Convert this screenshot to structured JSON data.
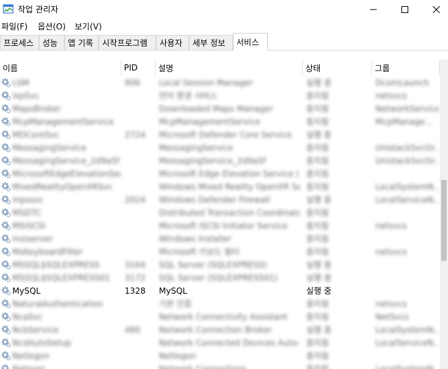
{
  "window": {
    "title": "작업 관리자"
  },
  "menu": [
    "파일(F)",
    "옵션(O)",
    "보기(V)"
  ],
  "tabs": [
    "프로세스",
    "성능",
    "앱 기록",
    "시작프로그램",
    "사용자",
    "세부 정보",
    "서비스"
  ],
  "active_tab": "서비스",
  "columns": {
    "name": "이름",
    "pid": "PID",
    "desc": "설명",
    "state": "상태",
    "group": "그룹"
  },
  "rows": [
    {
      "name": "LSM",
      "pid": "906",
      "desc": "Local Session Manager",
      "state": "실행 중",
      "group": "DcomLaunch",
      "blur": true
    },
    {
      "name": "lxpSvc",
      "pid": "",
      "desc": "언어 환경 서비스",
      "state": "중지됨",
      "group": "netsvcs",
      "blur": true
    },
    {
      "name": "MapsBroker",
      "pid": "",
      "desc": "Downloaded Maps Manager",
      "state": "중지됨",
      "group": "NetworkService",
      "blur": true
    },
    {
      "name": "McpManagementService",
      "pid": "",
      "desc": "McpManagementService",
      "state": "중지됨",
      "group": "McpManage...",
      "blur": true
    },
    {
      "name": "MDCoreSvc",
      "pid": "2724",
      "desc": "Microsoft Defender Core Service",
      "state": "실행 중",
      "group": "",
      "blur": true
    },
    {
      "name": "MessagingService",
      "pid": "",
      "desc": "MessagingService",
      "state": "중지됨",
      "group": "UnistackSvcGr...",
      "blur": true
    },
    {
      "name": "MessagingService_2d9a5f",
      "pid": "",
      "desc": "MessagingService_2d9a5f",
      "state": "중지됨",
      "group": "UnistackSvcGr...",
      "blur": true
    },
    {
      "name": "MicrosoftEdgeElevationSer...",
      "pid": "",
      "desc": "Microsoft Edge Elevation Service (...",
      "state": "중지됨",
      "group": "",
      "blur": true
    },
    {
      "name": "MixedRealityOpenXRSvc",
      "pid": "",
      "desc": "Windows Mixed Reality OpenXR Se...",
      "state": "중지됨",
      "group": "LocalSystemN...",
      "blur": true
    },
    {
      "name": "mpssvc",
      "pid": "2024",
      "desc": "Windows Defender Firewall",
      "state": "실행 중",
      "group": "LocalServiceN...",
      "blur": true
    },
    {
      "name": "MSDTC",
      "pid": "",
      "desc": "Distributed Transaction Coordinator",
      "state": "중지됨",
      "group": "",
      "blur": true
    },
    {
      "name": "MSiSCSI",
      "pid": "",
      "desc": "Microsoft iSCSI Initiator Service",
      "state": "중지됨",
      "group": "netsvcs",
      "blur": true
    },
    {
      "name": "msiserver",
      "pid": "",
      "desc": "Windows Installer",
      "state": "중지됨",
      "group": "",
      "blur": true
    },
    {
      "name": "MsKeyboardFilter",
      "pid": "",
      "desc": "Microsoft 키보드 필터",
      "state": "중지됨",
      "group": "netsvcs",
      "blur": true
    },
    {
      "name": "MSSQL$SQLEXPRESS",
      "pid": "3164",
      "desc": "SQL Server (SQLEXPRESS)",
      "state": "실행 중",
      "group": "",
      "blur": true
    },
    {
      "name": "MSSQL$SQLEXPRESS01",
      "pid": "3172",
      "desc": "SQL Server (SQLEXPRESS01)",
      "state": "실행 중",
      "group": "",
      "blur": true
    },
    {
      "name": "MySQL",
      "pid": "1328",
      "desc": "MySQL",
      "state": "실행 중",
      "group": "",
      "blur": false
    },
    {
      "name": "NaturalAuthentication",
      "pid": "",
      "desc": "기본 인증",
      "state": "중지됨",
      "group": "netsvcs",
      "blur": true
    },
    {
      "name": "NcaSvc",
      "pid": "",
      "desc": "Network Connectivity Assistant",
      "state": "중지됨",
      "group": "NetSvcs",
      "blur": true
    },
    {
      "name": "NcbService",
      "pid": "480",
      "desc": "Network Connection Broker",
      "state": "실행 중",
      "group": "LocalSystemN...",
      "blur": true
    },
    {
      "name": "NcdAutoSetup",
      "pid": "",
      "desc": "Network Connected Devices Auto-...",
      "state": "중지됨",
      "group": "LocalServiceN...",
      "blur": true
    },
    {
      "name": "Netlogon",
      "pid": "",
      "desc": "Netlogon",
      "state": "중지됨",
      "group": "",
      "blur": true
    },
    {
      "name": "Netman",
      "pid": "",
      "desc": "Network Connections",
      "state": "중지됨",
      "group": "LocalSystemN...",
      "blur": true
    }
  ]
}
